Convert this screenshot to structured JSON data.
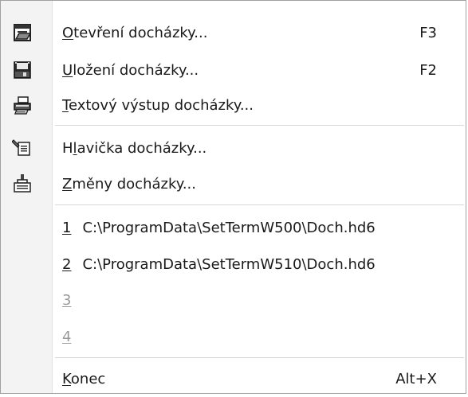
{
  "menu": {
    "items": [
      {
        "accel": "O",
        "rest": "tevření docházky...",
        "shortcut": "F3",
        "icon": "open-folder-icon"
      },
      {
        "accel": "U",
        "rest": "ložení docházky...",
        "shortcut": "F2",
        "icon": "save-disk-icon"
      },
      {
        "accel": "T",
        "rest": "extový výstup docházky...",
        "shortcut": "",
        "icon": "printer-icon"
      },
      {
        "pre": "H",
        "accel": "l",
        "rest": "avička docházky...",
        "shortcut": "",
        "icon": "header-edit-icon"
      },
      {
        "accel": "Z",
        "rest": "měny docházky...",
        "shortcut": "",
        "icon": "changes-stamp-icon"
      }
    ],
    "recent": [
      {
        "num": "1",
        "path": "C:\\ProgramData\\SetTermW500\\Doch.hd6"
      },
      {
        "num": "2",
        "path": "C:\\ProgramData\\SetTermW510\\Doch.hd6"
      },
      {
        "num": "3",
        "path": ""
      },
      {
        "num": "4",
        "path": ""
      }
    ],
    "exit": {
      "accel": "K",
      "rest": "onec",
      "shortcut": "Alt+X"
    }
  }
}
